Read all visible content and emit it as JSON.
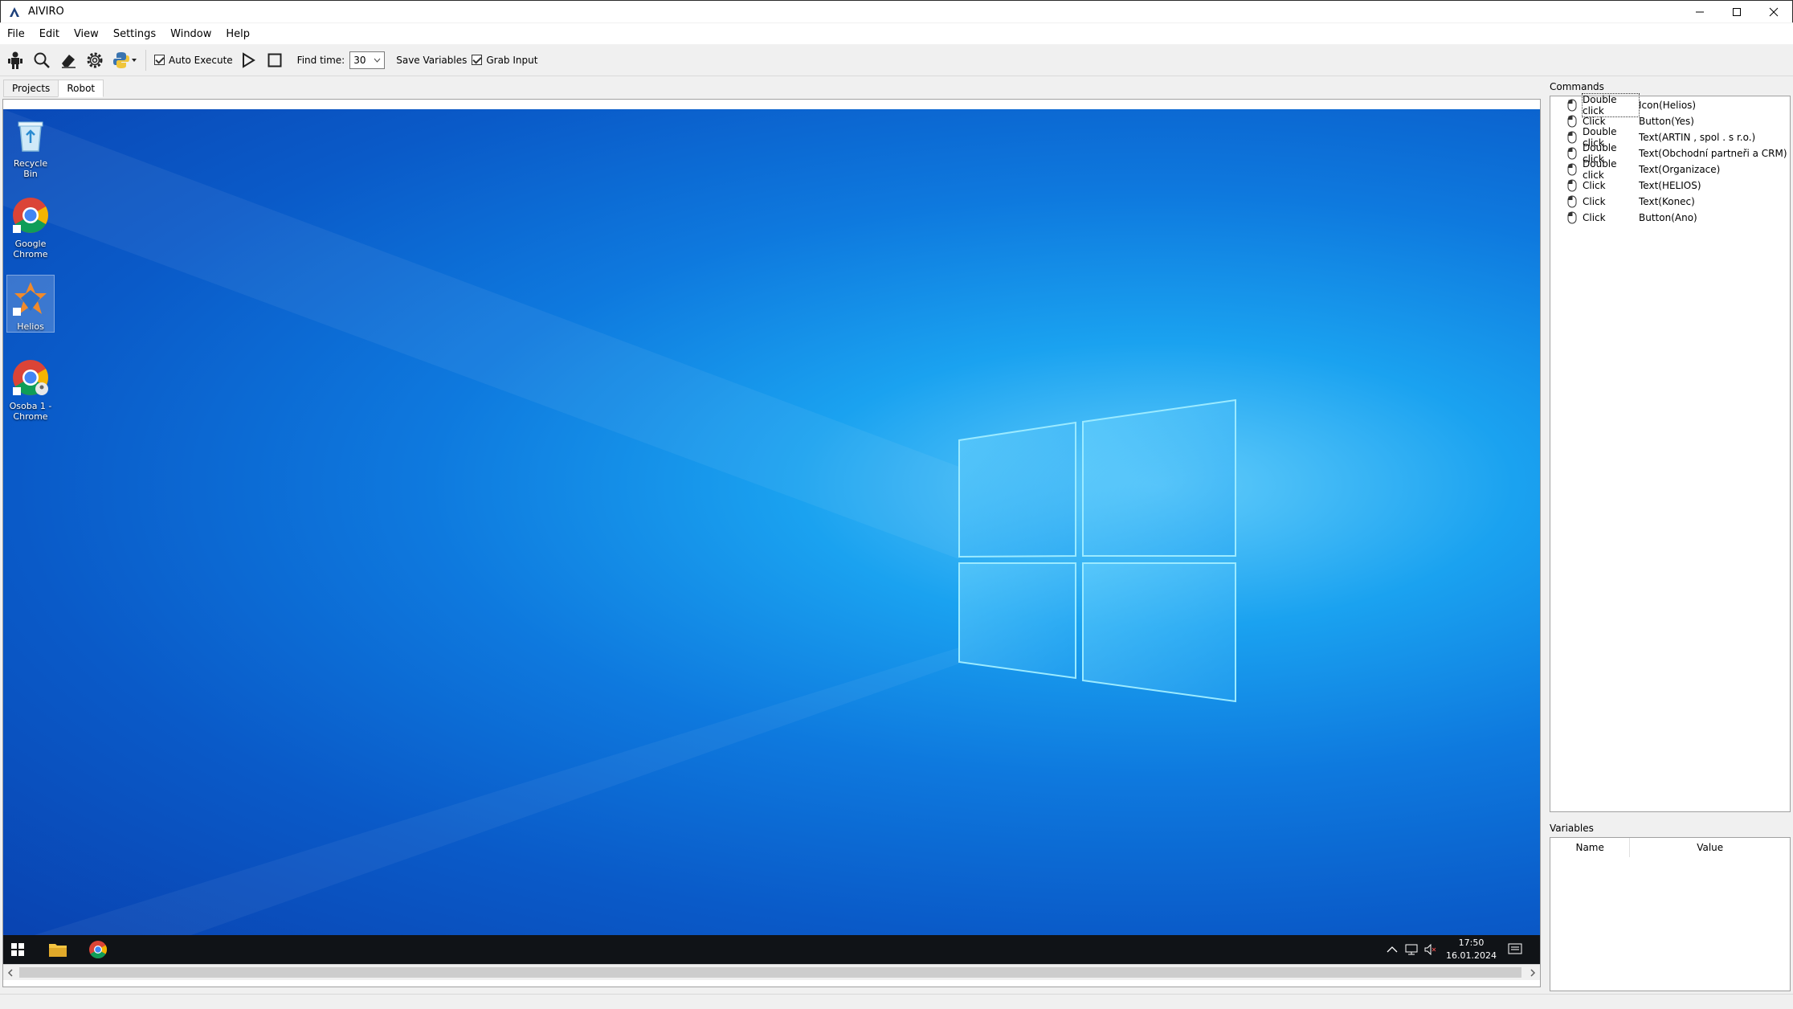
{
  "window": {
    "title": "AIVIRO"
  },
  "menu": [
    "File",
    "Edit",
    "View",
    "Settings",
    "Window",
    "Help"
  ],
  "toolbar": {
    "auto_execute_label": "Auto Execute",
    "auto_execute_checked": true,
    "find_time_label": "Find time:",
    "find_time_value": "30",
    "save_variables_label": "Save Variables",
    "grab_input_label": "Grab Input",
    "grab_input_checked": true
  },
  "tabs": [
    {
      "label": "Projects",
      "active": false
    },
    {
      "label": "Robot",
      "active": true
    }
  ],
  "desktop": {
    "icons": [
      {
        "label": "Recycle Bin",
        "icon": "recycle-bin-icon"
      },
      {
        "label": "Google Chrome",
        "icon": "chrome-icon"
      },
      {
        "label": "Helios",
        "icon": "helios-icon",
        "selected": true
      },
      {
        "label": "Osoba 1 - Chrome",
        "icon": "chrome-profile-icon"
      }
    ],
    "taskbar": {
      "time": "17:50",
      "date": "16.01.2024"
    }
  },
  "commands": {
    "label": "Commands",
    "rows": [
      {
        "action": "Double click",
        "target": "Icon(Helios)"
      },
      {
        "action": "Click",
        "target": "Button(Yes)"
      },
      {
        "action": "Double click",
        "target": "Text(ARTIN , spol . s r.o.)"
      },
      {
        "action": "Double click",
        "target": "Text(Obchodní partneři a CRM)"
      },
      {
        "action": "Double click",
        "target": "Text(Organizace)"
      },
      {
        "action": "Click",
        "target": "Text(HELIOS)"
      },
      {
        "action": "Click",
        "target": "Text(Konec)"
      },
      {
        "action": "Click",
        "target": "Button(Ano)"
      }
    ]
  },
  "variables": {
    "label": "Variables",
    "columns": [
      "Name",
      "Value"
    ]
  },
  "colors": {
    "desktop_blue": "#0e79de",
    "taskbar": "#101317"
  }
}
